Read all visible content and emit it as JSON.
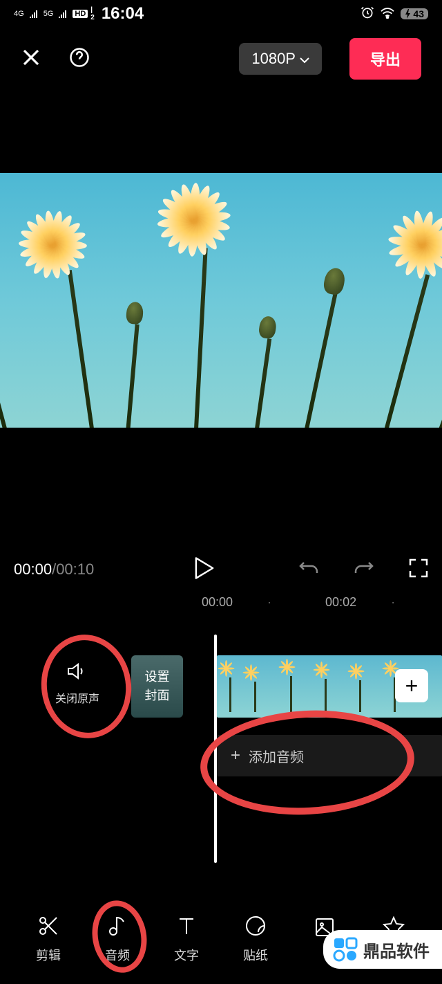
{
  "status": {
    "net1": "4G",
    "net2": "5G",
    "hd": "HD",
    "time": "16:04",
    "battery": "43"
  },
  "topbar": {
    "resolution": "1080P",
    "export": "导出"
  },
  "controls": {
    "current": "00:00",
    "sep": " / ",
    "total": "00:10"
  },
  "ruler": {
    "t0": "00:00",
    "t1": "00:02"
  },
  "timeline": {
    "mute_label": "关闭原声",
    "cover_line1": "设置",
    "cover_line2": "封面",
    "add_audio": "添加音频",
    "plus": "+",
    "plus_small": "+"
  },
  "toolbar": {
    "edit": "剪辑",
    "audio": "音频",
    "text": "文字",
    "sticker": "贴纸"
  },
  "watermark": "鼎品软件"
}
